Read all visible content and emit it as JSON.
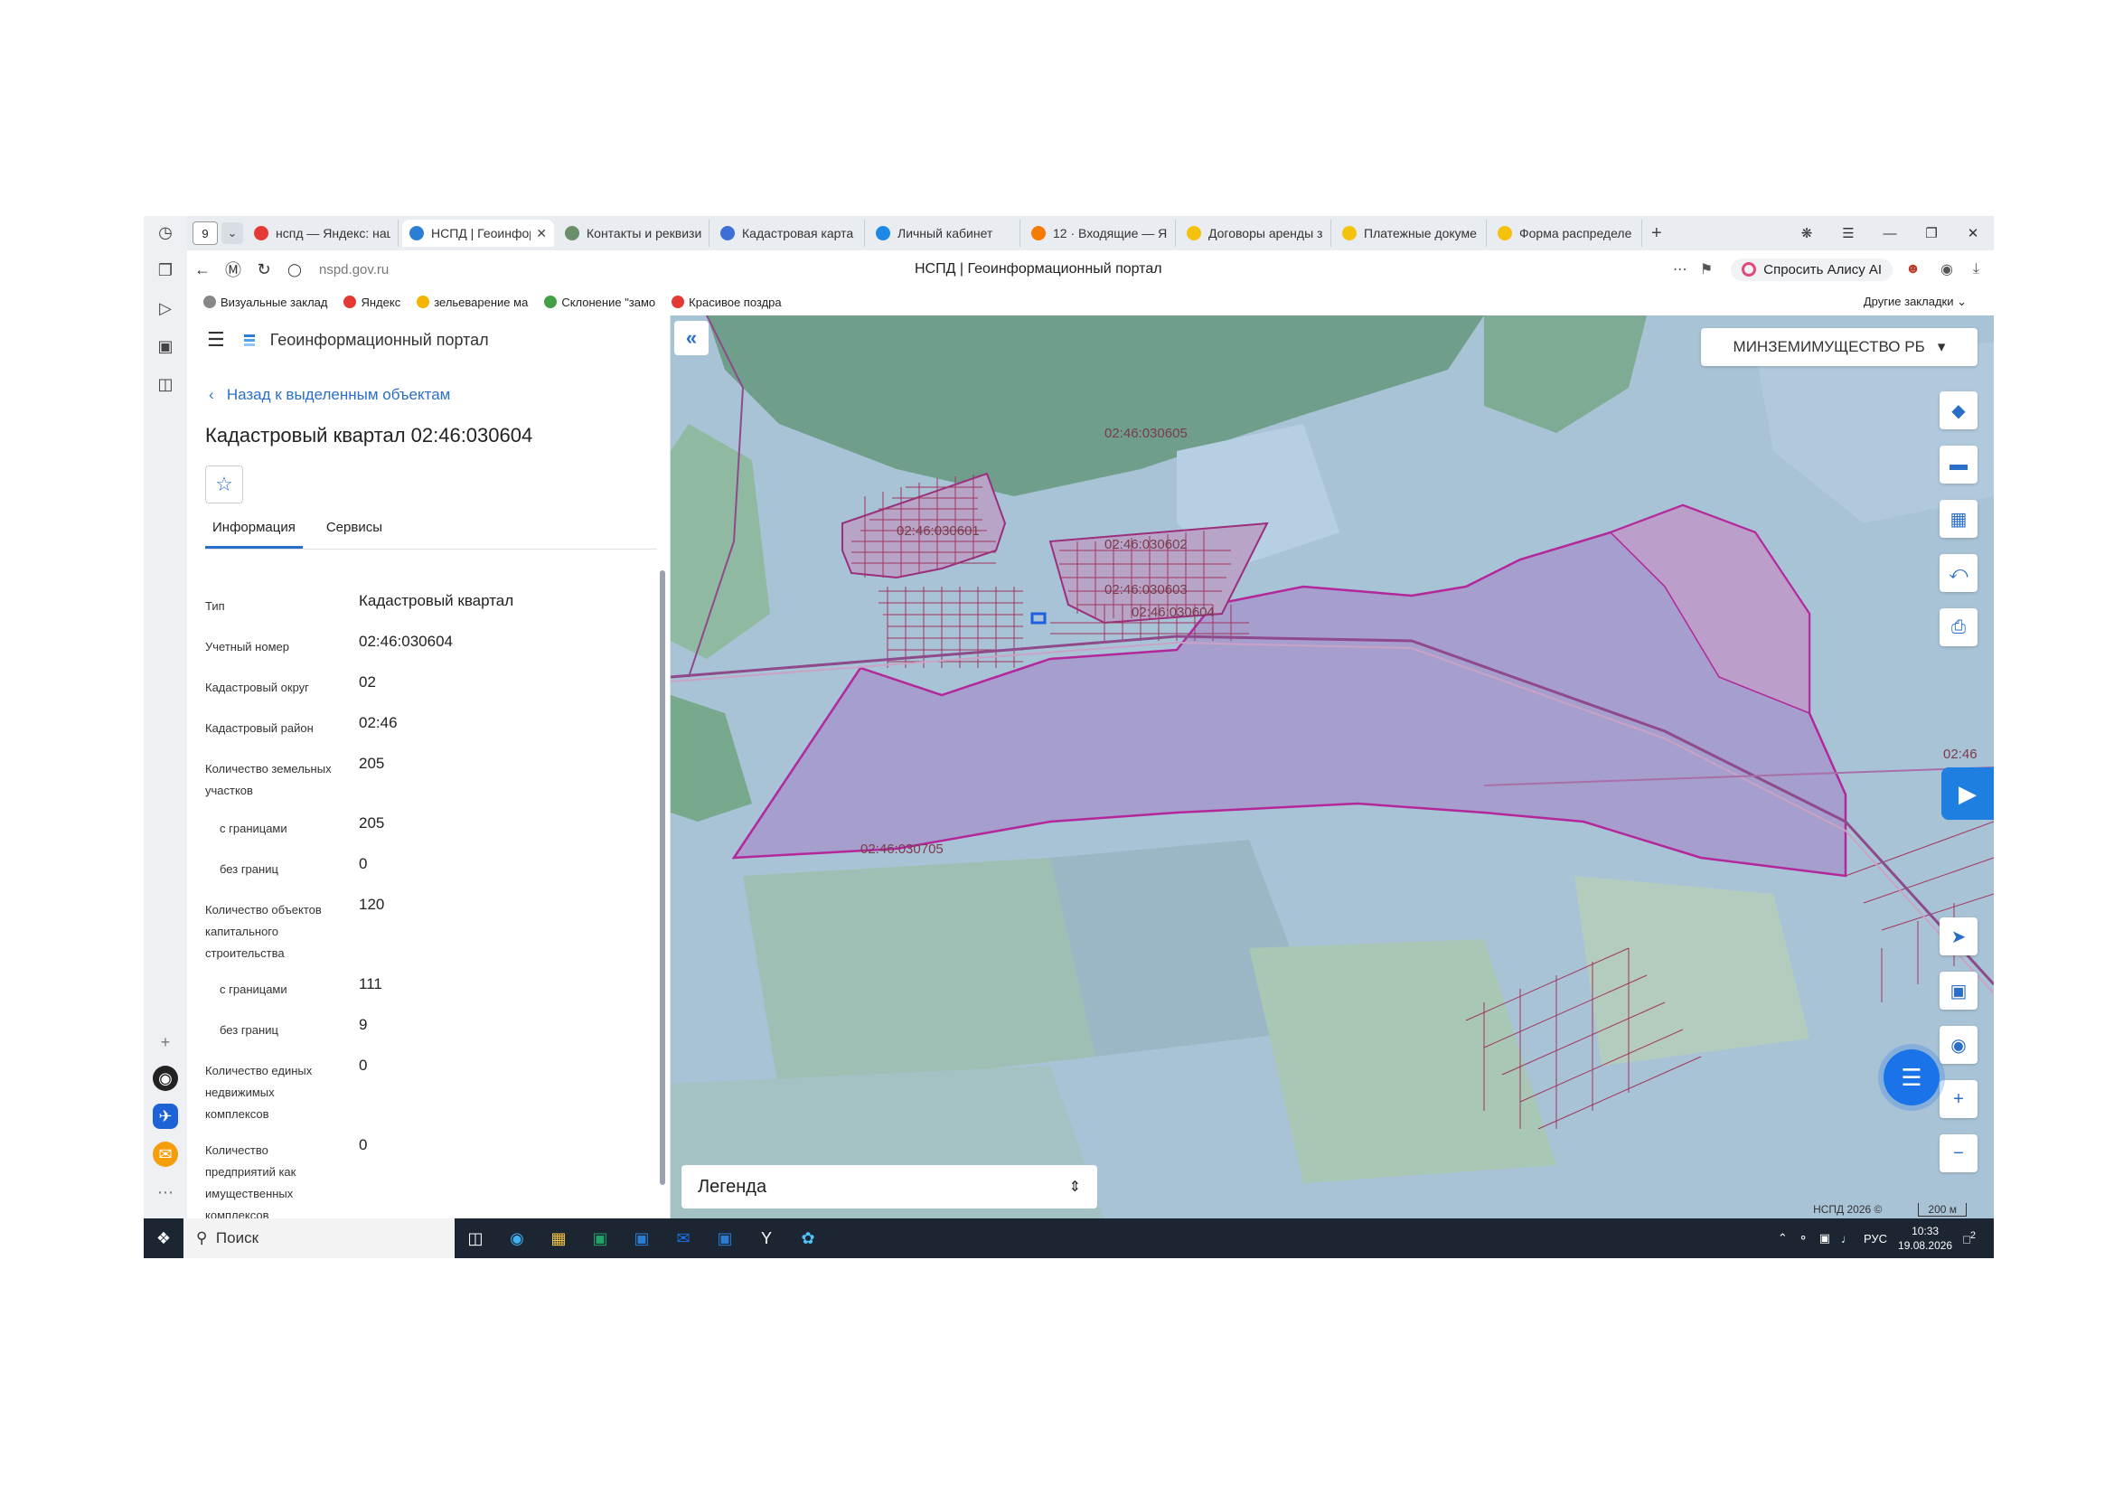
{
  "browser": {
    "tab_count": "9",
    "tabs": [
      {
        "label": "нспд — Яндекс: наш",
        "color": "#e53935",
        "icon": "yandex-icon"
      },
      {
        "label": "НСПД | Геоинформ",
        "color": "#2a7fd4",
        "icon": "nspd-icon",
        "active": true
      },
      {
        "label": "Контакты и реквизи",
        "color": "#6b8e6b",
        "icon": "globe-icon"
      },
      {
        "label": "Кадастровая карта",
        "color": "#3d6fd6",
        "icon": "map-icon"
      },
      {
        "label": "Личный кабинет",
        "color": "#1e88e5",
        "icon": "cabinet-icon"
      },
      {
        "label": "12 · Входящие — Ян",
        "color": "#f57c00",
        "icon": "mail-icon"
      },
      {
        "label": "Договоры аренды з",
        "color": "#f4c20d",
        "icon": "doc-icon"
      },
      {
        "label": "Платежные докуме",
        "color": "#f4c20d",
        "icon": "doc-icon"
      },
      {
        "label": "Форма распределе",
        "color": "#f4c20d",
        "icon": "doc-icon"
      }
    ],
    "url": "nspd.gov.ru",
    "page_title": "НСПД | Геоинформационный портал",
    "alice_label": "Спросить Алису AI",
    "bookmarks": [
      {
        "label": "Визуальные заклад",
        "color": "#888"
      },
      {
        "label": "Яндекс",
        "color": "#e53935"
      },
      {
        "label": "зельеварение ма",
        "color": "#f4b400"
      },
      {
        "label": "Склонение \"замо",
        "color": "#43a047"
      },
      {
        "label": "Красивое поздра",
        "color": "#e53935"
      }
    ],
    "other_bookmarks": "Другие закладки"
  },
  "panel": {
    "portal_name": "Геоинформационный портал",
    "back_link": "Назад к выделенным объектам",
    "title": "Кадастровый квартал 02:46:030604",
    "tabs": [
      "Информация",
      "Сервисы"
    ],
    "fields": [
      {
        "label": [
          "Тип"
        ],
        "value": "Кадастровый квартал",
        "indent": false
      },
      {
        "label": [
          "Учетный номер"
        ],
        "value": "02:46:030604",
        "indent": false
      },
      {
        "label": [
          "Кадастровый округ"
        ],
        "value": "02",
        "indent": false
      },
      {
        "label": [
          "Кадастровый район"
        ],
        "value": "02:46",
        "indent": false
      },
      {
        "label": [
          "Количество земельных",
          "участков"
        ],
        "value": "205",
        "indent": false
      },
      {
        "label": [
          "с границами"
        ],
        "value": "205",
        "indent": true
      },
      {
        "label": [
          "без границ"
        ],
        "value": "0",
        "indent": true
      },
      {
        "label": [
          "Количество объектов",
          "капитального",
          "строительства"
        ],
        "value": "120",
        "indent": false
      },
      {
        "label": [
          "с границами"
        ],
        "value": "111",
        "indent": true
      },
      {
        "label": [
          "без границ"
        ],
        "value": "9",
        "indent": true
      },
      {
        "label": [
          "Количество единых",
          "недвижимых",
          "комплексов"
        ],
        "value": "0",
        "indent": false
      },
      {
        "label": [
          "Количество",
          "предприятий как",
          "имущественных",
          "комплексов"
        ],
        "value": "0",
        "indent": false
      }
    ]
  },
  "map": {
    "org_selector": "МИНЗЕМИМУЩЕСТВО РБ",
    "legend_label": "Легенда",
    "attribution": "НСПД 2026 ©",
    "scale": "200 м",
    "quarter_labels": [
      "02:46:030605",
      "02:46:030601",
      "02:46:030602",
      "02:46:030603",
      "02:46:030604",
      "02:46:030705",
      "02:46"
    ]
  },
  "taskbar": {
    "search_placeholder": "Поиск",
    "lang": "РУС",
    "time": "10:33",
    "date": "19.08.2026",
    "notifications": "2"
  }
}
